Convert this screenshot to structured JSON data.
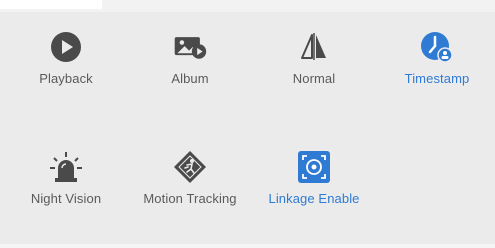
{
  "controls": [
    {
      "label": "Playback",
      "icon": "play-icon",
      "active": false
    },
    {
      "label": "Album",
      "icon": "album-icon",
      "active": false
    },
    {
      "label": "Normal",
      "icon": "mirror-icon",
      "active": false
    },
    {
      "label": "Timestamp",
      "icon": "timestamp-icon",
      "active": true
    },
    {
      "label": "Night Vision",
      "icon": "night-vision-icon",
      "active": false
    },
    {
      "label": "Motion Tracking",
      "icon": "motion-tracking-icon",
      "active": false
    },
    {
      "label": "Linkage Enable",
      "icon": "linkage-icon",
      "active": true
    }
  ],
  "colors": {
    "background": "#ebebeb",
    "icon": "#4a4a4a",
    "label": "#5a5a5a",
    "active": "#2f7bd3"
  }
}
